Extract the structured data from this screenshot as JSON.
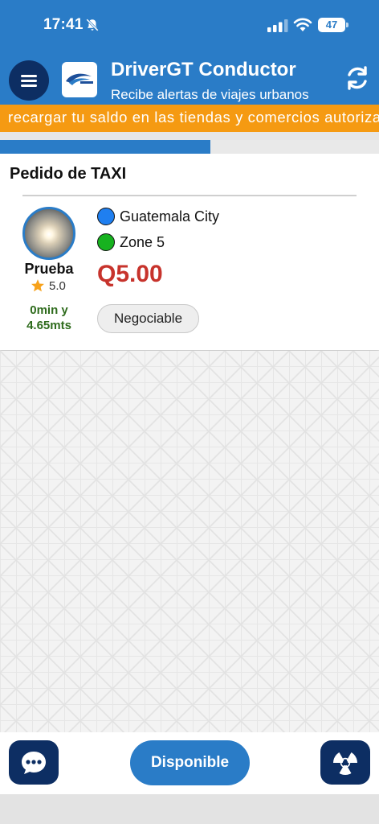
{
  "status_bar": {
    "time": "17:41",
    "battery": "47",
    "icons": [
      "bell-slash-icon",
      "signal-icon",
      "wifi-icon",
      "battery-icon"
    ]
  },
  "header": {
    "title": "DriverGT Conductor",
    "subtitle": "Recibe alertas de viajes urbanos",
    "icons": [
      "menu-icon",
      "app-logo",
      "refresh-icon"
    ]
  },
  "ticker": {
    "text": "recargar tu saldo en las tiendas y comercios autorizados"
  },
  "progress": {
    "fraction": 0.555
  },
  "order": {
    "title": "Pedido de TAXI",
    "user_name": "Prueba",
    "rating": "5.0",
    "eta_line1": "0min y",
    "eta_line2": "4.65mts",
    "origin": "Guatemala City",
    "destination": "Zone 5",
    "price": "Q5.00",
    "negotiable_label": "Negociable"
  },
  "footer": {
    "available_label": "Disponible",
    "icons": [
      "chat-icon",
      "radar-icon"
    ]
  },
  "colors": {
    "primary": "#2a7cc7",
    "dark_navy": "#0d2e63",
    "ticker_orange": "#f59a12",
    "price_red": "#c7332c",
    "eta_green": "#2e6b1c",
    "origin_dot": "#1f7ff0",
    "destination_dot": "#17b21f",
    "star": "#f7a21b"
  }
}
